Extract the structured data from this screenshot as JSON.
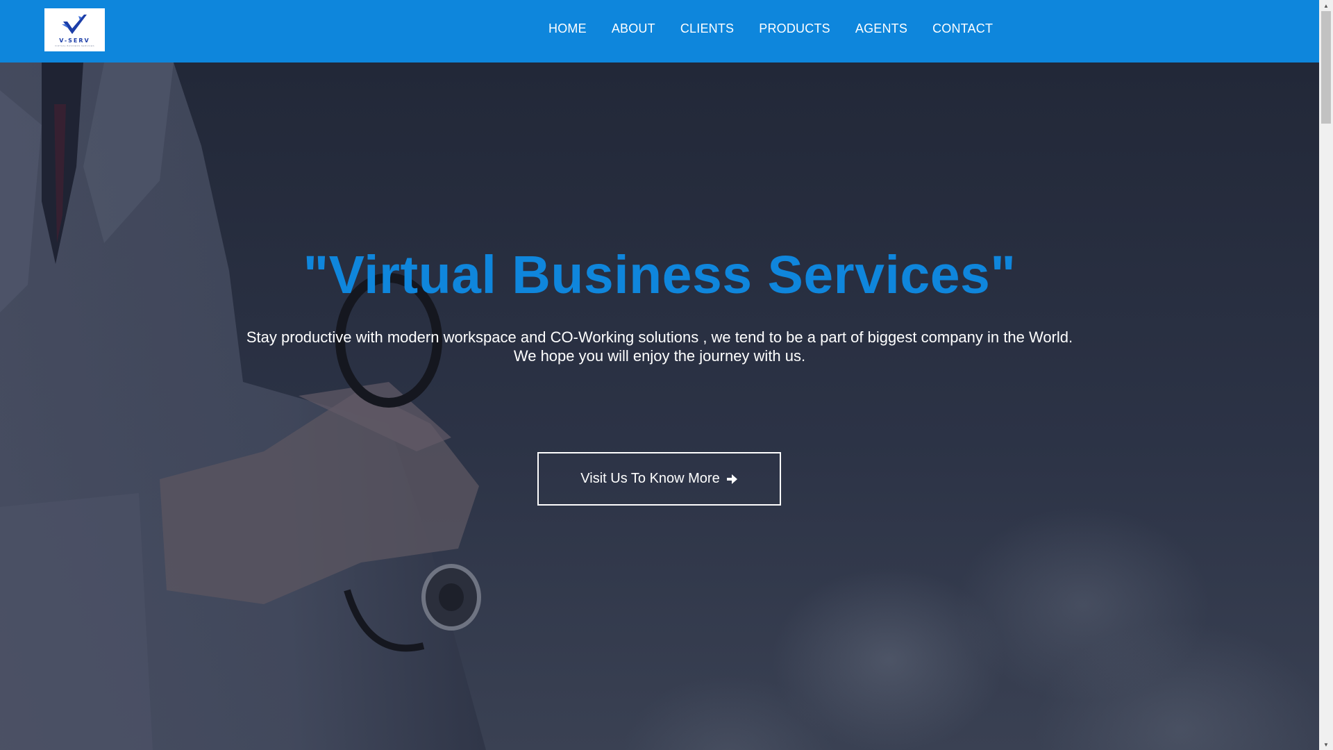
{
  "brand": {
    "logo_text": "V-SERV",
    "logo_tagline": "VIRTUAL BUSINESS SERVICES"
  },
  "nav": {
    "items": [
      {
        "label": "HOME"
      },
      {
        "label": "ABOUT"
      },
      {
        "label": "CLIENTS"
      },
      {
        "label": "PRODUCTS"
      },
      {
        "label": "AGENTS"
      },
      {
        "label": "CONTACT"
      }
    ]
  },
  "hero": {
    "title": "\"Virtual Business Services\"",
    "subtitle_line1": "Stay productive with modern workspace and CO-Working solutions , we tend to be a part of biggest company in the World.",
    "subtitle_line2": "We hope you will enjoy the journey with us.",
    "cta_label": "Visit Us To Know More",
    "cta_icon": "arrow-right-icon"
  },
  "colors": {
    "navbar": "#0e86dc",
    "title": "#0f86dc",
    "hero_overlay": "#2a3042",
    "text": "#ffffff"
  }
}
